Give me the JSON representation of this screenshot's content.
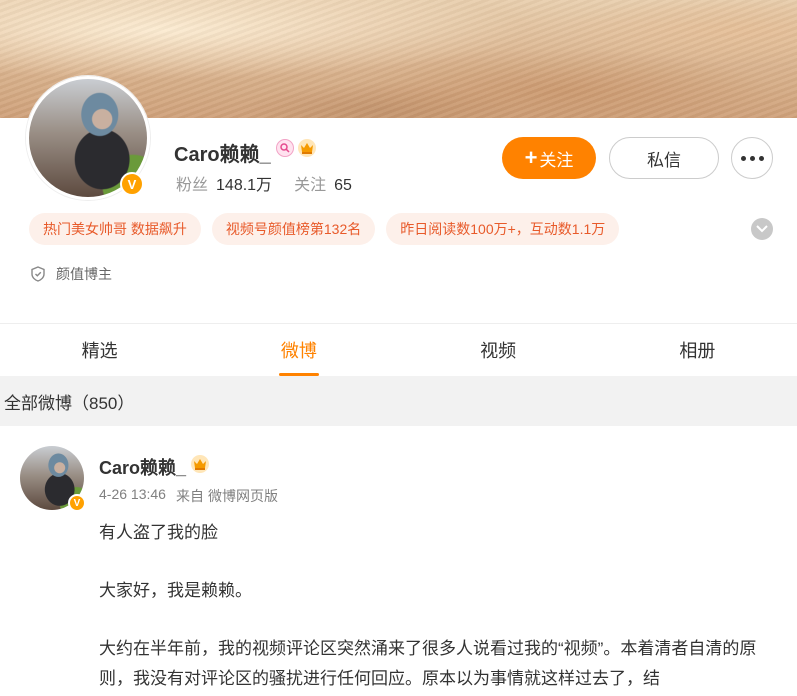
{
  "profile": {
    "name": "Caro赖赖_",
    "avatar_badge": "V",
    "stats": [
      {
        "label": "粉丝",
        "value": "148.1万"
      },
      {
        "label": "关注",
        "value": "65"
      }
    ],
    "follow_label": "关注",
    "message_label": "私信",
    "tags": [
      "热门美女帅哥 数据飙升",
      "视频号颜值榜第132名",
      "昨日阅读数100万+，互动数1.1万"
    ],
    "verified_text": "颜值博主"
  },
  "tabs": [
    {
      "label": "精选",
      "active": false
    },
    {
      "label": "微博",
      "active": true
    },
    {
      "label": "视频",
      "active": false
    },
    {
      "label": "相册",
      "active": false
    }
  ],
  "all_weibo_label": "全部微博（850）",
  "post": {
    "author": "Caro赖赖_",
    "time": "4-26 13:46",
    "source_prefix": "来自",
    "source": "微博网页版",
    "paragraphs": [
      "有人盗了我的脸",
      "大家好，我是赖赖。",
      "大约在半年前，我的视频评论区突然涌来了很多人说看过我的“视频”。本着清者自清的原则，我没有对评论区的骚扰进行任何回应。原本以为事情就这样过去了，结"
    ]
  },
  "colors": {
    "accent": "#ff8200",
    "tag_bg": "#fdf0ea",
    "tag_text": "#e85a2a",
    "vip_badge": "#ffa100"
  },
  "icons": {
    "more": "more-horizontal-icon",
    "expand": "chevron-down-icon",
    "verified": "shield-icon"
  }
}
